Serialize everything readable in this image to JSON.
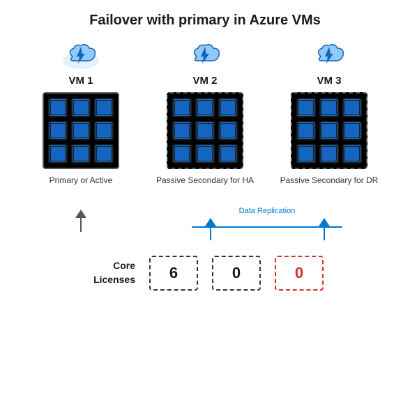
{
  "title": "Failover with primary in Azure VMs",
  "vms": [
    {
      "id": "vm1",
      "label": "VM 1",
      "box_style": "solid",
      "description": "Primary or Active",
      "chips": 9
    },
    {
      "id": "vm2",
      "label": "VM 2",
      "box_style": "dashed",
      "description": "Passive Secondary for HA",
      "chips": 9
    },
    {
      "id": "vm3",
      "label": "VM 3",
      "box_style": "dashed",
      "description": "Passive Secondary for DR",
      "chips": 9
    }
  ],
  "replication_label": "Data Replication",
  "licenses": {
    "label": "Core\nLicenses",
    "values": [
      "6",
      "0",
      "0"
    ],
    "styles": [
      "black",
      "black",
      "red"
    ]
  }
}
